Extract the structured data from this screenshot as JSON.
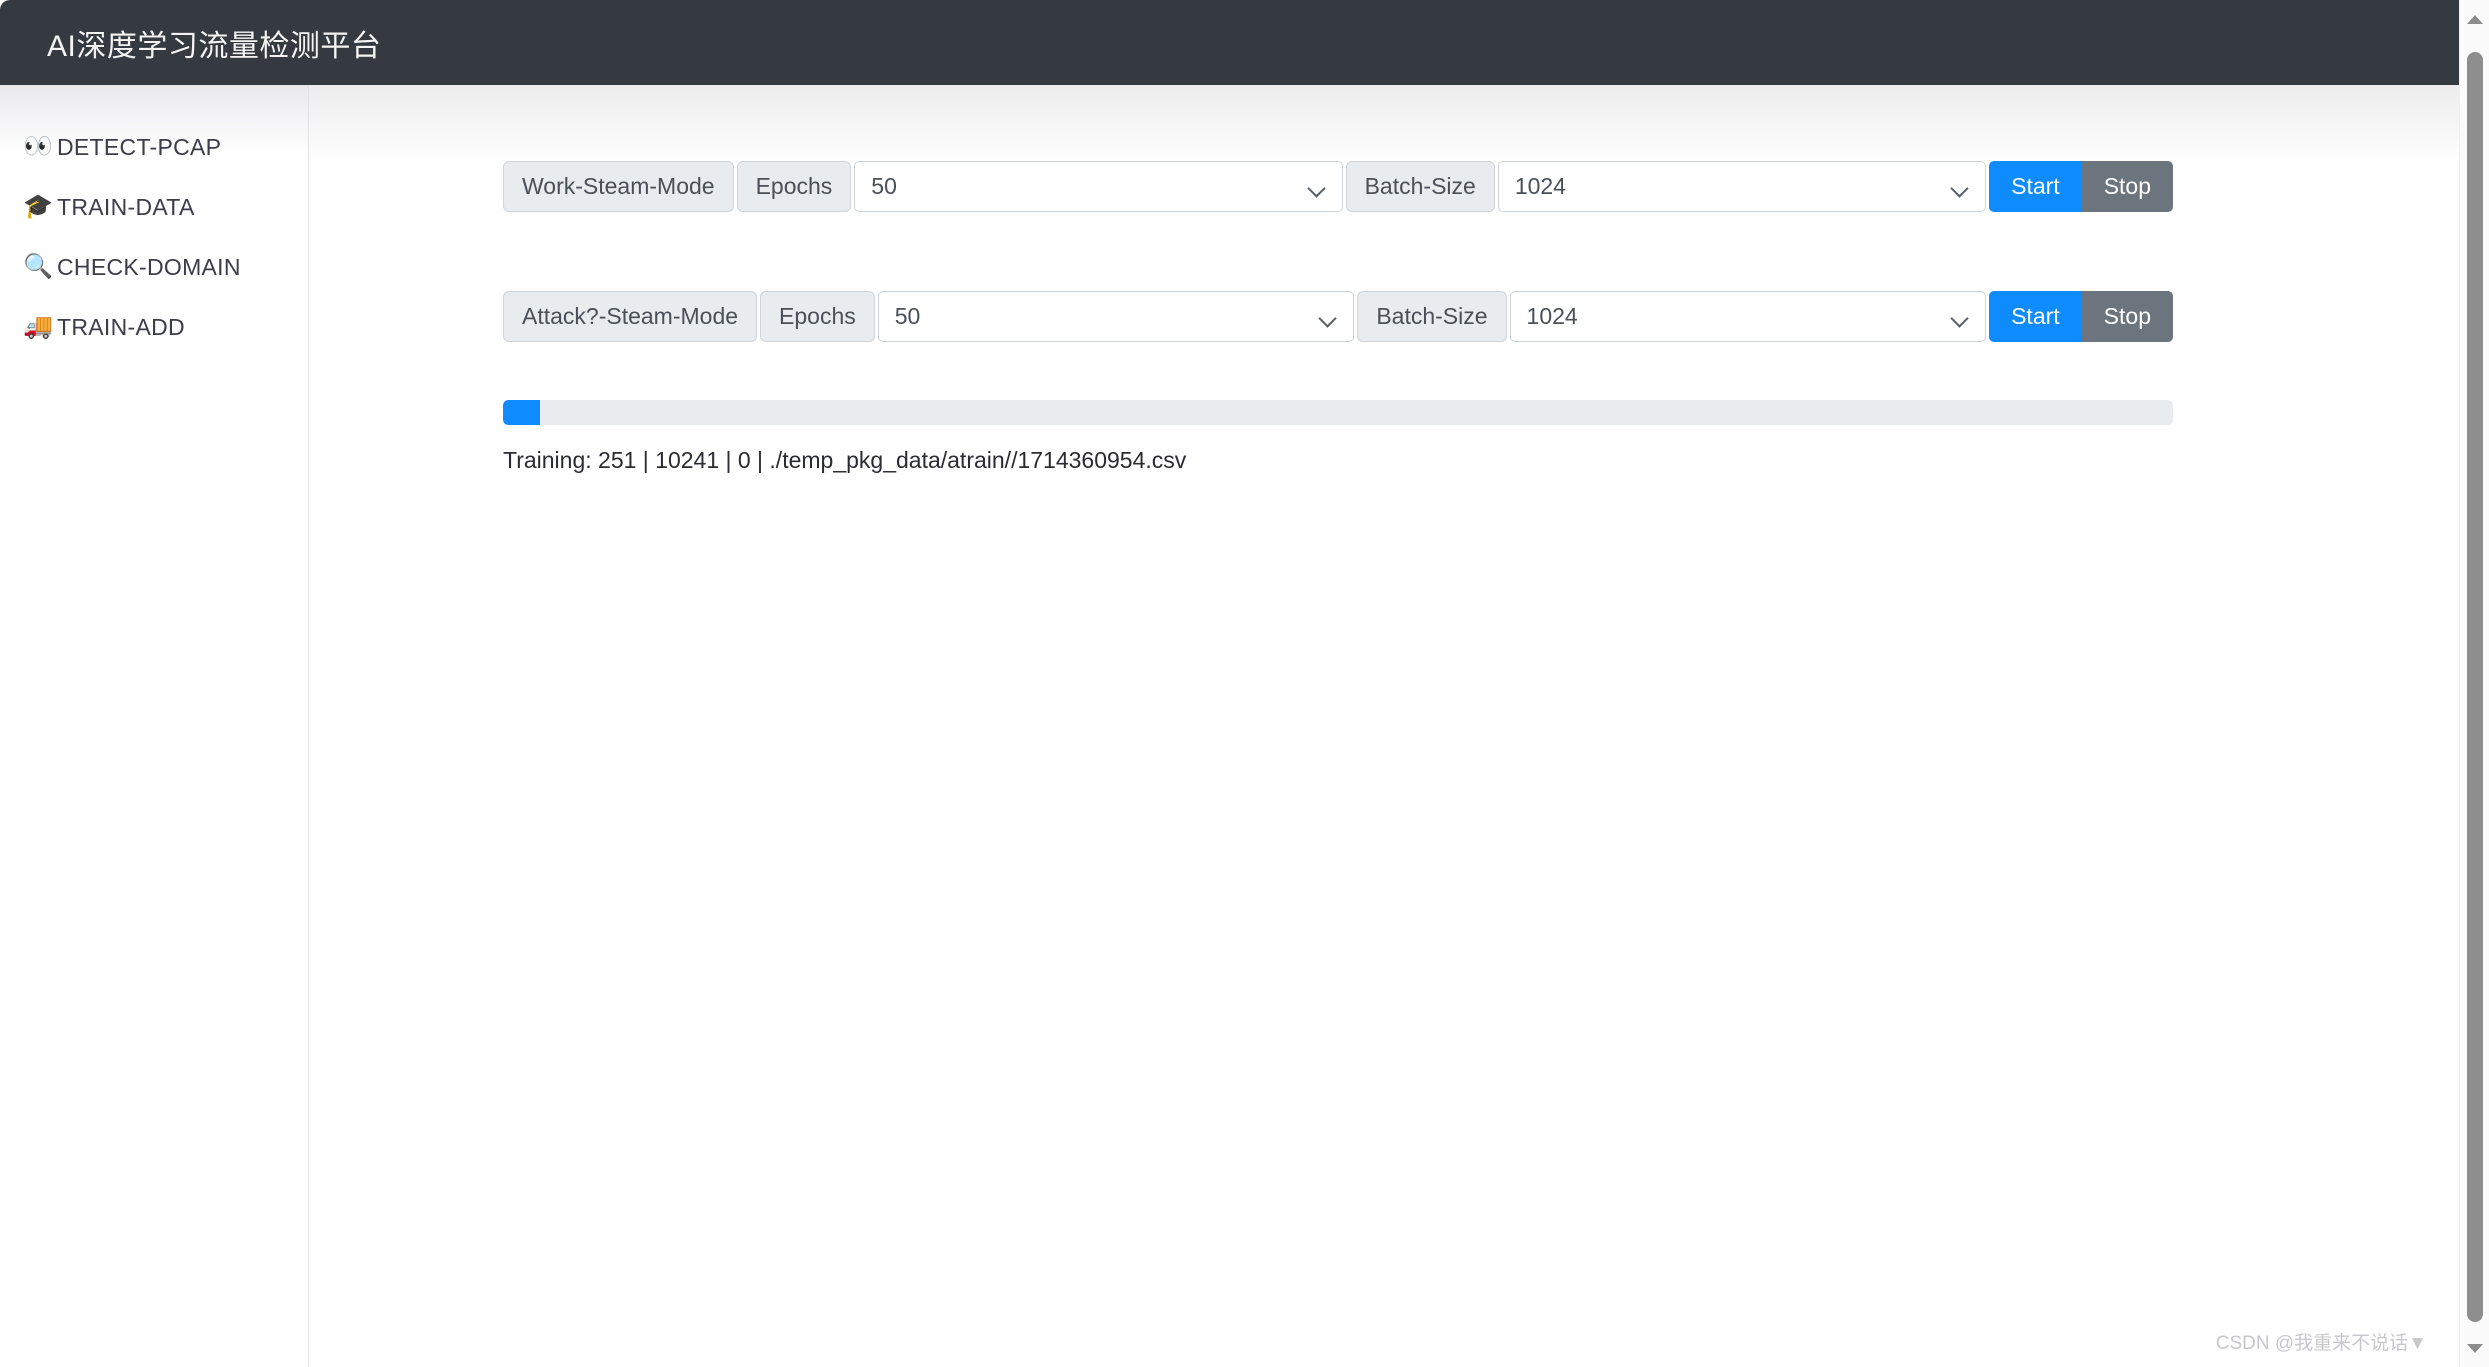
{
  "header": {
    "title": "AI深度学习流量检测平台"
  },
  "sidebar": {
    "items": [
      {
        "icon": "eyes-icon",
        "glyph": "👀",
        "label": "DETECT-PCAP"
      },
      {
        "icon": "graduation-cap-icon",
        "glyph": "🎓",
        "label": "TRAIN-DATA"
      },
      {
        "icon": "magnifier-icon",
        "glyph": "🔍",
        "label": "CHECK-DOMAIN"
      },
      {
        "icon": "truck-icon",
        "glyph": "🚚",
        "label": "TRAIN-ADD"
      }
    ]
  },
  "main": {
    "rows": [
      {
        "mode_label": "Work-Steam-Mode",
        "epochs_label": "Epochs",
        "epochs_value": "50",
        "epochs_options": [
          "50"
        ],
        "batch_label": "Batch-Size",
        "batch_value": "1024",
        "batch_options": [
          "1024"
        ],
        "start_label": "Start",
        "stop_label": "Stop"
      },
      {
        "mode_label": "Attack?-Steam-Mode",
        "epochs_label": "Epochs",
        "epochs_value": "50",
        "epochs_options": [
          "50"
        ],
        "batch_label": "Batch-Size",
        "batch_value": "1024",
        "batch_options": [
          "1024"
        ],
        "start_label": "Start",
        "stop_label": "Stop"
      }
    ],
    "progress": {
      "percent": 2.2,
      "status_text": "Training: 251 | 10241 | 0 | ./temp_pkg_data/atrain//1714360954.csv"
    }
  },
  "watermark": {
    "text": "CSDN @我重来不说话▼"
  },
  "colors": {
    "header_bg": "#343a40",
    "accent_blue": "#0d8bff",
    "stop_gray": "#6c757d",
    "addon_bg": "#e9ecef",
    "track_bg": "#e9ecef"
  }
}
